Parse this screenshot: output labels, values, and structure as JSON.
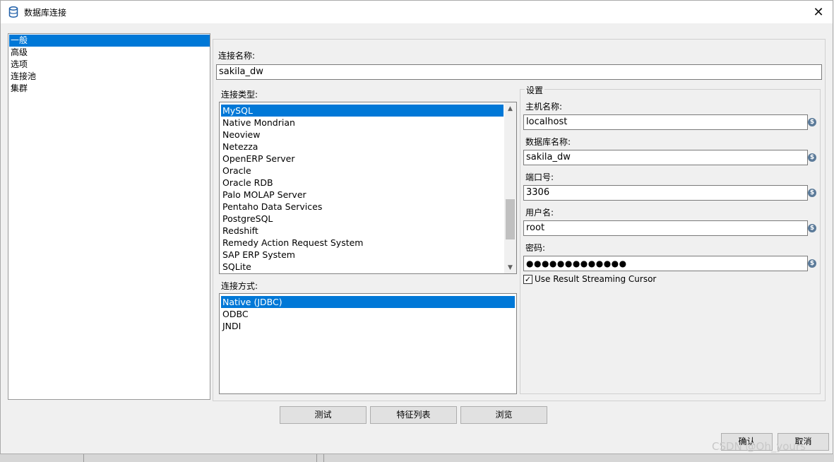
{
  "window": {
    "title": "数据库连接",
    "close_glyph": "✕"
  },
  "nav": {
    "items": [
      "一般",
      "高级",
      "选项",
      "连接池",
      "集群"
    ],
    "selected_index": 0
  },
  "connection": {
    "name_label": "连接名称:",
    "name_value": "sakila_dw"
  },
  "conn_type": {
    "label": "连接类型:",
    "items": [
      "MySQL",
      "Native Mondrian",
      "Neoview",
      "Netezza",
      "OpenERP Server",
      "Oracle",
      "Oracle RDB",
      "Palo MOLAP Server",
      "Pentaho Data Services",
      "PostgreSQL",
      "Redshift",
      "Remedy Action Request System",
      "SAP ERP System",
      "SQLite"
    ],
    "selected_index": 0
  },
  "access": {
    "label": "连接方式:",
    "items": [
      "Native (JDBC)",
      "ODBC",
      "JNDI"
    ],
    "selected_index": 0
  },
  "settings": {
    "title": "设置",
    "host_label": "主机名称:",
    "host_value": "localhost",
    "db_label": "数据库名称:",
    "db_value": "sakila_dw",
    "port_label": "端口号:",
    "port_value": "3306",
    "user_label": "用户名:",
    "user_value": "root",
    "pass_label": "密码:",
    "pass_value": "●●●●●●●●●●●●●",
    "var_glyph": "$",
    "streaming_label": "Use Result Streaming Cursor",
    "streaming_checked": true,
    "check_glyph": "✓"
  },
  "actions": {
    "test": "测试",
    "features": "特征列表",
    "explore": "浏览"
  },
  "footer": {
    "ok": "确认",
    "cancel": "取消"
  },
  "watermark": "CSDN @Oh_yours",
  "colors": {
    "selection": "#0078d7",
    "variable_icon": "#5b7a99"
  }
}
